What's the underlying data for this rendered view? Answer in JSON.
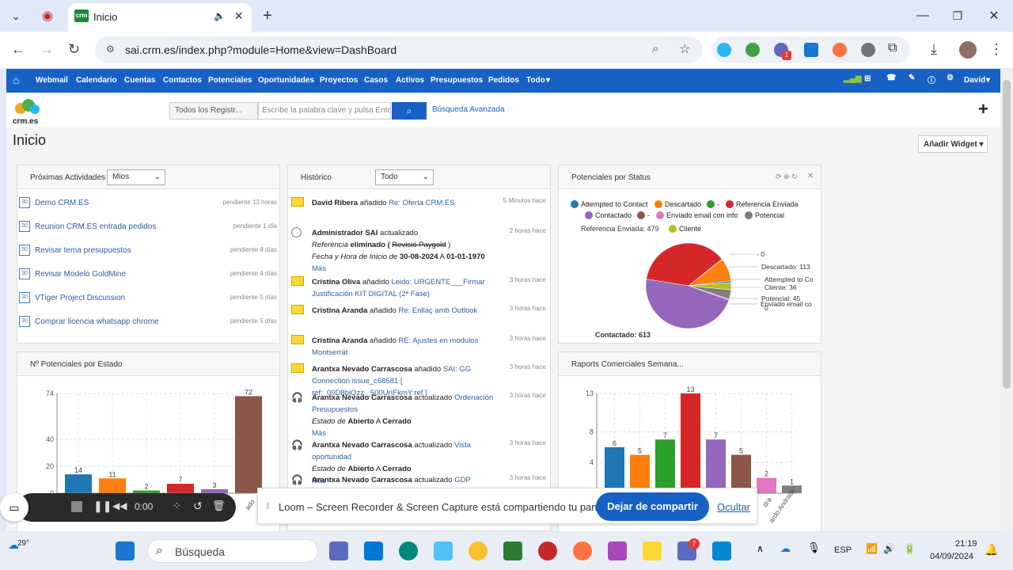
{
  "browser": {
    "tab_title": "Inicio",
    "url": "sai.crm.es/index.php?module=Home&view=DashBoard",
    "ext_badge": "1"
  },
  "crm_nav": {
    "items": [
      "Webmail",
      "Calendario",
      "Cuentas",
      "Contactos",
      "Potenciales",
      "Oportunidades",
      "Proyectos",
      "Casos",
      "Activos",
      "Presupuestos",
      "Pedidos",
      "Todo"
    ],
    "user": "David"
  },
  "header": {
    "logo_text": "crm.es",
    "search_scope": "Todos los Registr...",
    "search_placeholder": "Escribe la palabra clave y pulsa Enter",
    "advanced": "Búsqueda Avanzada"
  },
  "page": {
    "title": "Inicio",
    "add_widget": "Añadir Widget"
  },
  "activities": {
    "title": "Próximas Actividades",
    "filter": "Mios",
    "items": [
      {
        "name": "Demo CRM.ES",
        "status": "pendiente 13 horas"
      },
      {
        "name": "Reunion CRM.ES entrada pedidos",
        "status": "pendiente 1 día"
      },
      {
        "name": "Revisar tema presupuestos",
        "status": "pendiente 4 días"
      },
      {
        "name": "Revisar Modelo GoldMine",
        "status": "pendiente 4 días"
      },
      {
        "name": "VTiger Project Discussion",
        "status": "pendiente 5 días"
      },
      {
        "name": "Comprar licencia whatsapp chrome",
        "status": "pendiente 5 días"
      }
    ]
  },
  "history": {
    "title": "Histórico",
    "filter": "Todo",
    "items": [
      {
        "who": "David Ribera",
        "verb": "añadido",
        "link": "Re: Oferta CRM.ES",
        "time": "5 Minutos hace"
      },
      {
        "who": "Administrador SAI",
        "verb": "actualizado",
        "time": "2 horas hace",
        "f1_label": "Referencia",
        "f1_mid": "eliminado (",
        "f1_old": "Revisió Paygold",
        "f1_end": ")",
        "f2_label": "Fecha y Hora de Inicio",
        "f2_de": "de",
        "f2_from": "30-08-2024",
        "f2_a": "A",
        "f2_to": "01-01-1970",
        "more": "Más"
      },
      {
        "who": "Cristina Oliva",
        "verb": "añadido",
        "link": "Leido: URGENTE___Firmar Justificación KIT DIGITAL (2ª Fase)",
        "time": "3 horas hace"
      },
      {
        "who": "Cristina Aranda",
        "verb": "añadido",
        "link": "Re: Enllaç amb Outlook",
        "time": "3 horas hace"
      },
      {
        "who": "Cristina Aranda",
        "verb": "añadido",
        "link": "RE: Ajustes en modulos Montserrat",
        "time": "3 horas hace"
      },
      {
        "who": "Arantxa Nevado Carrascosa",
        "verb": "añadido",
        "link": "SAI: GG Connection issue_c68581 [ ref:_00D8bjQzz._500UrIFkmY:ref ]",
        "time": "3 horas hace"
      },
      {
        "who": "Arantxa Nevado Carrascosa",
        "verb": "actualizado",
        "link": "Ordenación Presupuestos",
        "time": "3 horas hace",
        "f_label": "Estado",
        "f_de": "de",
        "f_from": "Abierto",
        "f_a": "A",
        "f_to": "Cerrado",
        "more": "Más"
      },
      {
        "who": "Arantxa Nevado Carrascosa",
        "verb": "actualizado",
        "link": "Vista oportunidad",
        "time": "3 horas hace",
        "f_label": "Estado",
        "f_de": "de",
        "f_from": "Abierto",
        "f_a": "A",
        "f_to": "Cerrado",
        "more": "Más"
      },
      {
        "who": "Arantxa Nevado Carrascosa",
        "verb": "actualizado",
        "link": "GDP",
        "time": "3 horas hace"
      }
    ]
  },
  "status_widget": {
    "title": "Potenciales por Status"
  },
  "potenciales_widget": {
    "title": "Nº Potenciales por Estado"
  },
  "raports_widget": {
    "title": "Raports Comerciales Semana..."
  },
  "chart_data": [
    {
      "type": "pie",
      "title": "Potenciales por Status",
      "legend": [
        "Attempted to Contact",
        "Descartado",
        "-",
        "Referencia Enviada",
        "Contactado",
        "-",
        "Enviado email con info",
        "Potencial",
        "Cliente"
      ],
      "colors": [
        "#1f77b4",
        "#ff7f0e",
        "#2ca02c",
        "#d62728",
        "#9467bd",
        "#8c564b",
        "#e377c2",
        "#7f7f7f",
        "#bcbd22"
      ],
      "labels": [
        "Referencia Enviada: 479",
        "- 0",
        "Descartado: 113",
        "Attempted to Co",
        "Cliente: 36",
        "Potencial: 45",
        "Enviado email co",
        "Contactado: 613",
        "0"
      ],
      "slices": [
        {
          "name": "Referencia Enviada",
          "value": 479,
          "color": "#d62728"
        },
        {
          "name": "-",
          "value": 3,
          "color": "#2ca02c"
        },
        {
          "name": "Descartado",
          "value": 113,
          "color": "#ff7f0e"
        },
        {
          "name": "Attempted to Contact",
          "value": 8,
          "color": "#1f77b4"
        },
        {
          "name": "Cliente",
          "value": 36,
          "color": "#bcbd22"
        },
        {
          "name": "Potencial",
          "value": 45,
          "color": "#7f7f7f"
        },
        {
          "name": "Enviado email con info",
          "value": 6,
          "color": "#e377c2"
        },
        {
          "name": "Contactado",
          "value": 613,
          "color": "#9467bd"
        }
      ]
    },
    {
      "type": "bar",
      "title": "Nº Potenciales por Estado",
      "yticks": [
        0,
        20,
        40,
        74
      ],
      "ylim": [
        0,
        74
      ],
      "values": [
        14,
        11,
        2,
        7,
        3,
        72
      ],
      "colors": [
        "#1f77b4",
        "#ff7f0e",
        "#2ca02c",
        "#d62728",
        "#9467bd",
        "#8c564b"
      ],
      "xlabel_partial": "ado"
    },
    {
      "type": "bar",
      "title": "Raports Comerciales Semana...",
      "yticks": [
        0,
        4,
        8,
        13
      ],
      "ylim": [
        0,
        13
      ],
      "values": [
        6,
        5,
        7,
        13,
        7,
        5,
        2,
        1
      ],
      "colors": [
        "#1f77b4",
        "#ff7f0e",
        "#2ca02c",
        "#d62728",
        "#9467bd",
        "#8c564b",
        "#e377c2",
        "#7f7f7f"
      ],
      "xlabels_partial": [
        "dra",
        "ardo Andrade"
      ]
    }
  ],
  "recorder": {
    "time": "0:00"
  },
  "share": {
    "message": "Loom – Screen Recorder & Screen Capture está compartiendo tu pantalla.",
    "stop": "Dejar de compartir",
    "hide": "Ocultar"
  },
  "taskbar": {
    "temp": "29°",
    "search": "Búsqueda",
    "lang": "ESP",
    "time": "21:19",
    "date": "04/09/2024",
    "teams_badge": "7"
  }
}
